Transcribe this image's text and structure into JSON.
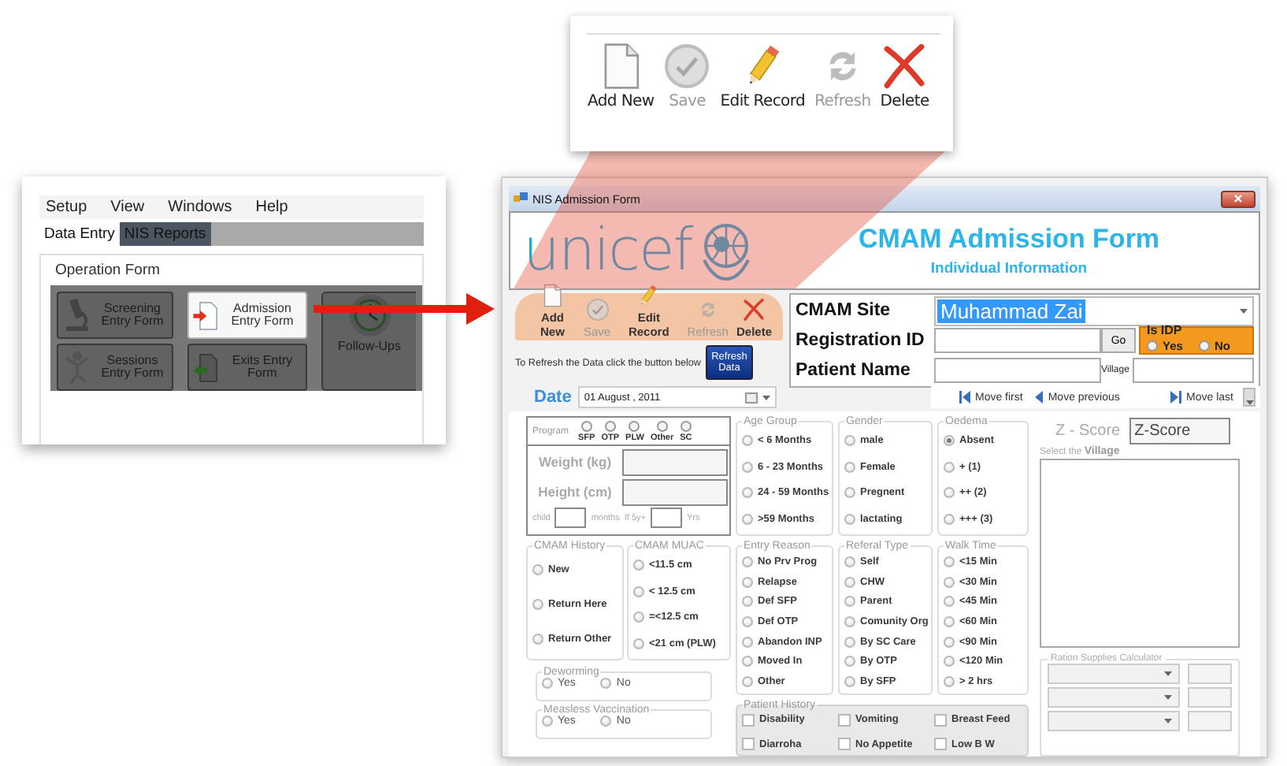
{
  "callout_toolbar": {
    "buttons": [
      {
        "kind": "new",
        "label": "Add New",
        "disabled": false
      },
      {
        "kind": "save",
        "label": "Save",
        "disabled": true
      },
      {
        "kind": "edit",
        "label": "Edit Record",
        "disabled": false
      },
      {
        "kind": "refresh",
        "label": "Refresh",
        "disabled": true
      },
      {
        "kind": "delete",
        "label": "Delete",
        "disabled": false
      }
    ]
  },
  "menu_window": {
    "menu": [
      "Setup",
      "View",
      "Windows",
      "Help"
    ],
    "tabs": [
      {
        "label": "Data Entry",
        "selected": true
      },
      {
        "label": "NIS Reports",
        "selected": false
      }
    ],
    "group_title": "Operation Form",
    "buttons": [
      {
        "kind": "screening",
        "label": "Screening Entry Form",
        "highlighted": false
      },
      {
        "kind": "sessions",
        "label": "Sessions Entry Form",
        "highlighted": false
      },
      {
        "kind": "admission",
        "label": "Admission Entry Form",
        "highlighted": true
      },
      {
        "kind": "exits",
        "label": "Exits Entry Form",
        "highlighted": false
      },
      {
        "kind": "followups",
        "label": "Follow-Ups",
        "highlighted": false
      }
    ]
  },
  "form": {
    "title": "NIS Admission Form",
    "logo": "unicef",
    "heading": "CMAM Admission Form",
    "subheading": "Individual Information",
    "toolbar": [
      {
        "kind": "new",
        "label": "Add New",
        "disabled": false
      },
      {
        "kind": "save",
        "label": "Save",
        "disabled": true
      },
      {
        "kind": "edit",
        "label": "Edit Record",
        "disabled": false
      },
      {
        "kind": "refresh",
        "label": "Refresh",
        "disabled": true
      },
      {
        "kind": "delete",
        "label": "Delete",
        "disabled": false
      }
    ],
    "refresh_hint": "To Refresh the Data click the button below",
    "refresh_button": "Refresh Data",
    "site": {
      "label": "CMAM Site",
      "value": "Muhammad Zai"
    },
    "registration_label": "Registration ID",
    "go_button": "Go",
    "idp": {
      "title": "Is IDP",
      "options": [
        {
          "label": "Yes",
          "selected": false
        },
        {
          "label": "No",
          "selected": false
        }
      ]
    },
    "patient_name_label": "Patient Name",
    "village_label": "Village",
    "navigator": [
      {
        "kind": "first",
        "label": "Move first"
      },
      {
        "kind": "previous",
        "label": "Move previous"
      },
      {
        "kind": "last",
        "label": "Move last"
      }
    ],
    "date": {
      "label": "Date",
      "value": "01 August , 2011"
    },
    "program": {
      "title": "Program",
      "options": [
        {
          "label": "SFP",
          "selected": false
        },
        {
          "label": "OTP",
          "selected": false
        },
        {
          "label": "PLW",
          "selected": false
        },
        {
          "label": "Other",
          "selected": false
        },
        {
          "label": "SC",
          "selected": false
        }
      ]
    },
    "weight_label": "Weight (kg)",
    "height_label": "Height (cm)",
    "child_label": "child",
    "months_label": "months",
    "age_over5_label": "If 5y+",
    "years_label": "Yrs",
    "age_group": {
      "title": "Age Group",
      "options": [
        {
          "label": "< 6 Months",
          "selected": false
        },
        {
          "label": "6 - 23 Months",
          "selected": false
        },
        {
          "label": "24 - 59 Months",
          "selected": false
        },
        {
          "label": ">59 Months",
          "selected": false
        }
      ]
    },
    "gender": {
      "title": "Gender",
      "options": [
        {
          "label": "male",
          "selected": false
        },
        {
          "label": "Female",
          "selected": false
        },
        {
          "label": "Pregnent",
          "selected": false
        },
        {
          "label": "lactating",
          "selected": false
        }
      ]
    },
    "oedema": {
      "title": "Oedema",
      "options": [
        {
          "label": "Absent",
          "selected": true
        },
        {
          "label": "+ (1)",
          "selected": false
        },
        {
          "label": "++ (2)",
          "selected": false
        },
        {
          "label": "+++ (3)",
          "selected": false
        }
      ]
    },
    "cmam_history": {
      "title": "CMAM History",
      "options": [
        {
          "label": "New",
          "selected": false
        },
        {
          "label": "Return Here",
          "selected": false
        },
        {
          "label": "Return Other",
          "selected": false
        }
      ]
    },
    "cmam_muac": {
      "title": "CMAM MUAC",
      "options": [
        {
          "label": "<11.5 cm",
          "selected": false
        },
        {
          "label": "< 12.5 cm",
          "selected": false
        },
        {
          "label": "=<12.5 cm",
          "selected": false
        },
        {
          "label": "<21 cm (PLW)",
          "selected": false
        }
      ]
    },
    "entry_reason": {
      "title": "Entry Reason",
      "options": [
        {
          "label": "No Prv Prog",
          "selected": false
        },
        {
          "label": "Relapse",
          "selected": false
        },
        {
          "label": "Def SFP",
          "selected": false
        },
        {
          "label": "Def OTP",
          "selected": false
        },
        {
          "label": "Abandon INP",
          "selected": false
        },
        {
          "label": "Moved In",
          "selected": false
        },
        {
          "label": "Other",
          "selected": false
        }
      ]
    },
    "referral_type": {
      "title": "Referal Type",
      "options": [
        {
          "label": "Self",
          "selected": false
        },
        {
          "label": "CHW",
          "selected": false
        },
        {
          "label": "Parent",
          "selected": false
        },
        {
          "label": "Comunity Org",
          "selected": false
        },
        {
          "label": "By SC Care",
          "selected": false
        },
        {
          "label": "By OTP",
          "selected": false
        },
        {
          "label": "By SFP",
          "selected": false
        }
      ]
    },
    "walk_time": {
      "title": "Walk Time",
      "options": [
        {
          "label": "<15 Min",
          "selected": false
        },
        {
          "label": "<30 Min",
          "selected": false
        },
        {
          "label": "<45 Min",
          "selected": false
        },
        {
          "label": "<60 Min",
          "selected": false
        },
        {
          "label": "<90 Min",
          "selected": false
        },
        {
          "label": "<120 Min",
          "selected": false
        },
        {
          "label": "> 2 hrs",
          "selected": false
        }
      ]
    },
    "deworming": {
      "title": "Deworming",
      "options": [
        {
          "label": "Yes",
          "selected": false
        },
        {
          "label": "No",
          "selected": false
        }
      ]
    },
    "measles_vaccination": {
      "title": "Measless Vaccination",
      "options": [
        {
          "label": "Yes",
          "selected": false
        },
        {
          "label": "No",
          "selected": false
        }
      ]
    },
    "patient_history": {
      "title": "Patient History",
      "options": [
        {
          "label": "Disability",
          "checked": false
        },
        {
          "label": "Vomiting",
          "checked": false
        },
        {
          "label": "Breast Feed",
          "checked": false
        },
        {
          "label": "Diarroha",
          "checked": false
        },
        {
          "label": "No Appetite",
          "checked": false
        },
        {
          "label": "Low B W",
          "checked": false
        }
      ]
    },
    "z_score": {
      "label": "Z - Score",
      "value": "Z-Score"
    },
    "village_prompt": "Select the **Village**",
    "ration_title": "Ration Supplies Calculator"
  }
}
